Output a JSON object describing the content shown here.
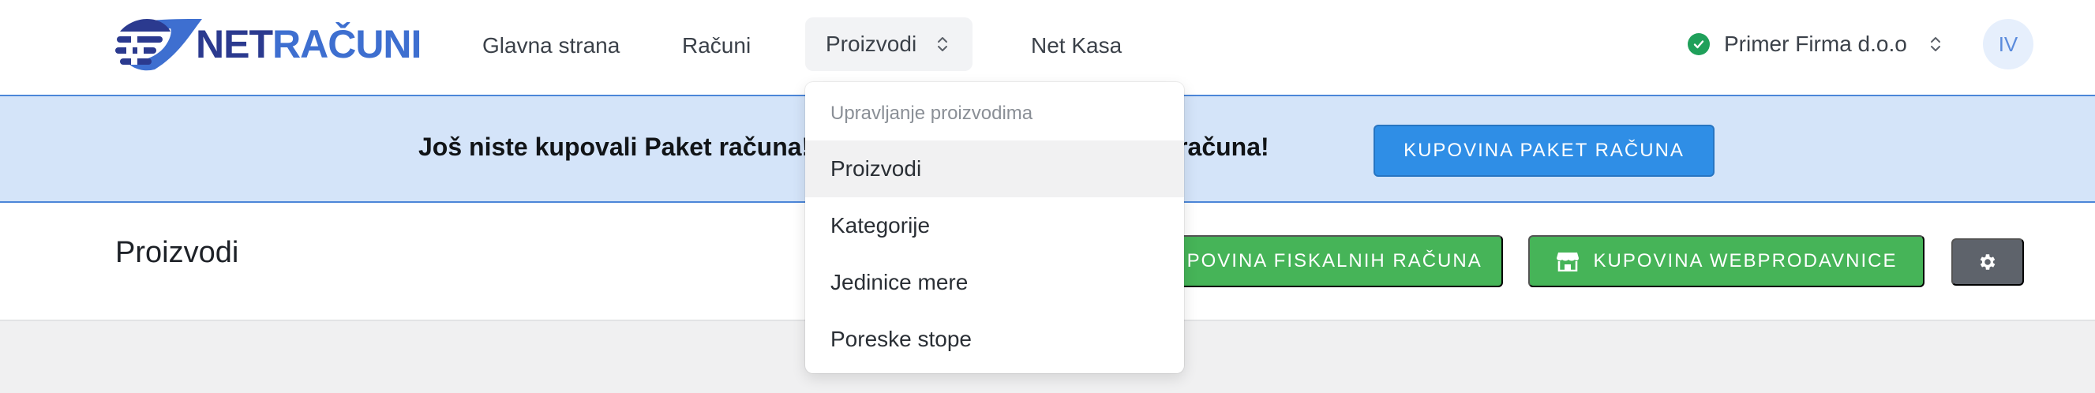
{
  "brand": {
    "net": "NET",
    "racuni": "RAČUNI"
  },
  "nav": {
    "home": "Glavna strana",
    "racuni": "Računi",
    "proizvodi": "Proizvodi",
    "kasa": "Net Kasa"
  },
  "company": {
    "name": "Primer Firma d.o.o",
    "status_icon": "check-circle-icon"
  },
  "user": {
    "initials": "IV"
  },
  "banner": {
    "text": "Još niste kupovali Paket računa! Kupite odmah svoj prvi Paket računa!",
    "button": "KUPOVINA PAKET RAČUNA"
  },
  "page": {
    "title": "Proizvodi",
    "buttons": {
      "fiskal": "KUPOVINA FISKALNIH RAČUNA",
      "web": "KUPOVINA WEBPRODAVNICE"
    }
  },
  "dropdown": {
    "header": "Upravljanje proizvodima",
    "items": [
      "Proizvodi",
      "Kategorije",
      "Jedinice mere",
      "Poreske stope"
    ],
    "active_index": 0
  },
  "colors": {
    "accent_blue": "#2f8ee6",
    "banner_bg": "#d4e4f9",
    "success_green": "#46b458",
    "gear_gray": "#5e636b",
    "logo_navy": "#2b3a8f"
  }
}
